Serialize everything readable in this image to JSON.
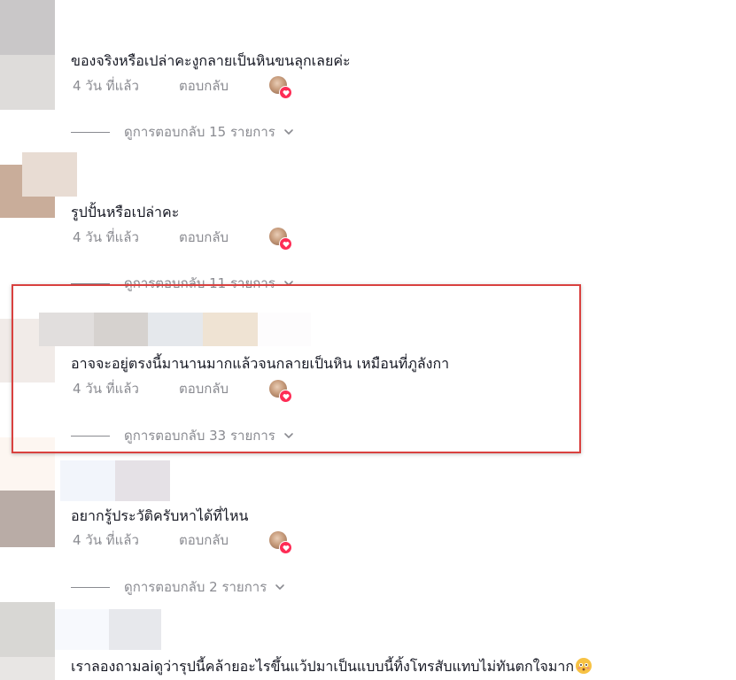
{
  "comments": [
    {
      "text": "ของจริงหรือเปล่าคะงูกลายเป็นหินขนลุกเลยค่ะ",
      "time": "4 วัน ที่แล้ว",
      "reply_label": "ตอบกลับ",
      "view_replies": "ดูการตอบกลับ 15 รายการ"
    },
    {
      "text": "รูปปั้นหรือเปล่าคะ",
      "time": "4 วัน ที่แล้ว",
      "reply_label": "ตอบกลับ",
      "view_replies": "ดูการตอบกลับ 11 รายการ"
    },
    {
      "text": "อาจจะอยู่ตรงนี้มานานมากแล้วจนกลายเป็นหิน เหมือนที่ภูลังกา",
      "time": "4 วัน ที่แล้ว",
      "reply_label": "ตอบกลับ",
      "view_replies": "ดูการตอบกลับ 33 รายการ"
    },
    {
      "text": "อยากรู้ประวัติครับหาได้ที่ไหน",
      "time": "4 วัน ที่แล้ว",
      "reply_label": "ตอบกลับ",
      "view_replies": "ดูการตอบกลับ 2 รายการ"
    },
    {
      "text": "เราลองถามaiดูว่ารุปนี้คล้ายอะไรขึ้นแว้ปมาเป็นแบบนี้ทิ้งโทรสับแทบไม่ทันตกใจมาก"
    }
  ],
  "icons": {
    "author_liked": "creator-liked-heart-icon",
    "chevron": "chevron-down-icon",
    "emoji": "flushed-face-emoji"
  },
  "colors": {
    "text_primary": "#161823",
    "text_secondary": "#8a8b91",
    "highlight_border": "#d9413f",
    "heart": "#fe2c55"
  }
}
